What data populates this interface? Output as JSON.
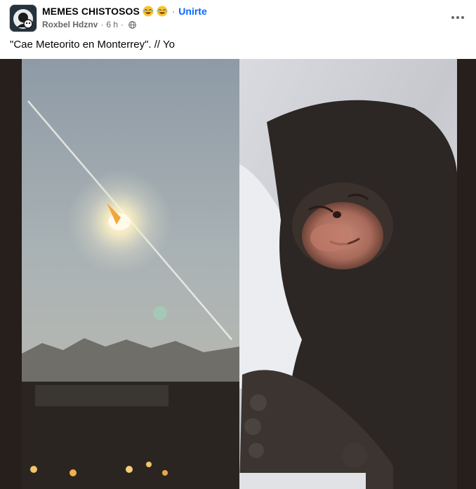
{
  "post": {
    "group_name": "MEMES CHISTOSOS",
    "emojis": [
      "rolling-on-floor-laughing-emoji",
      "rolling-on-floor-laughing-emoji"
    ],
    "separator": "·",
    "join_label": "Unirte",
    "author": "Roxbel Hdznv",
    "time": "6 h",
    "privacy_icon": "globe-icon",
    "more_icon": "more-options-icon",
    "caption": "\"Cae Meteorito en Monterrey\". // Yo",
    "image": {
      "panels": [
        "meteor-sky-photo",
        "sleeping-monkey-photo"
      ]
    }
  },
  "colors": {
    "link": "#0866ff",
    "secondary_text": "#65676b",
    "primary_text": "#050505",
    "media_background": "#271f1b"
  }
}
